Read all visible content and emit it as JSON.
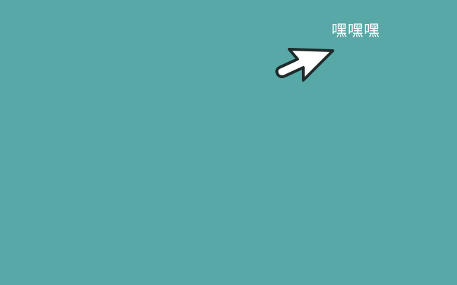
{
  "desktop": {
    "background_color": "#58a8a7"
  },
  "cursor": {
    "icon": "arrow-cursor-icon",
    "label": "嘿嘿嘿",
    "fill_color": "#ffffff",
    "outline_color": "#1e2b2b"
  }
}
